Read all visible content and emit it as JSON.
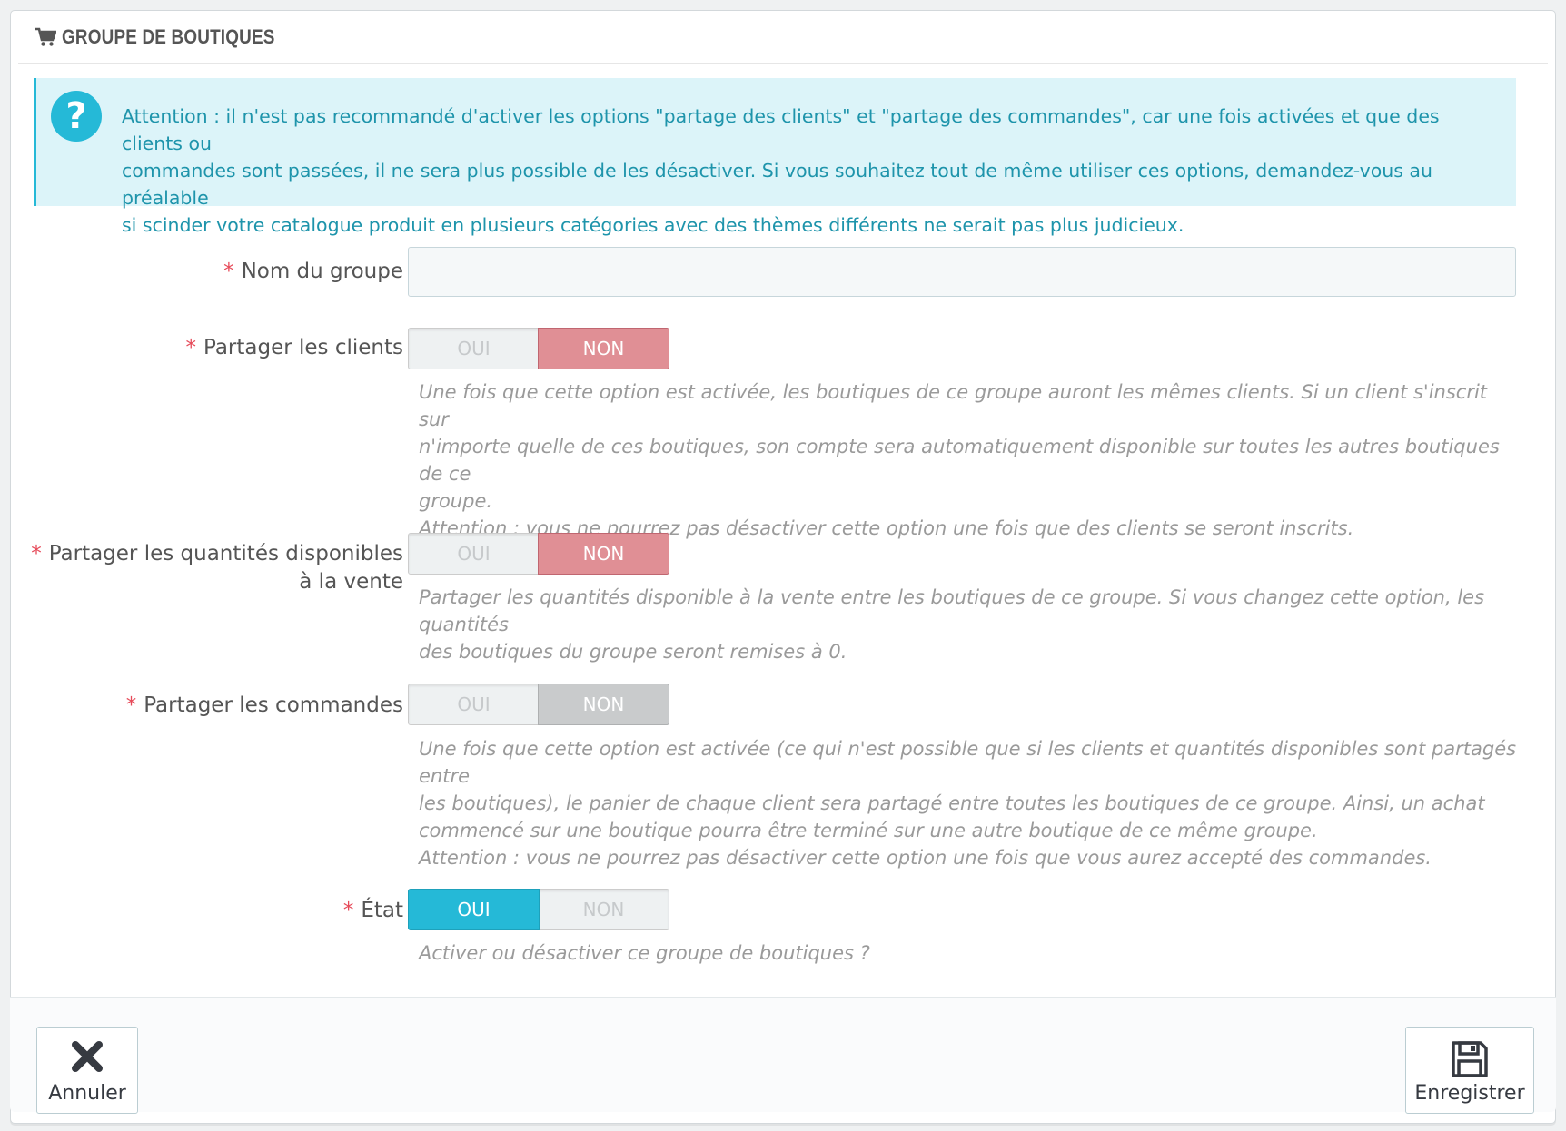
{
  "panel": {
    "title": "GROUPE DE BOUTIQUES",
    "icon": "cart-icon"
  },
  "alert": {
    "icon": "question-icon",
    "text": "Attention : il n'est pas recommandé d'activer les options \"partage des clients\" et \"partage des commandes\", car une fois activées et que des clients ou\ncommandes sont passées, il ne sera plus possible de les désactiver. Si vous souhaitez tout de même utiliser ces options, demandez-vous au préalable\nsi scinder votre catalogue produit en plusieurs catégories avec des thèmes différents ne serait pas plus judicieux."
  },
  "fields": {
    "group_name": {
      "label": "Nom du groupe",
      "value": ""
    },
    "share_customers": {
      "label": "Partager les clients",
      "yes": "OUI",
      "no": "NON",
      "selected": "NON",
      "help": "Une fois que cette option est activée, les boutiques de ce groupe auront les mêmes clients. Si un client s'inscrit sur\nn'importe quelle de ces boutiques, son compte sera automatiquement disponible sur toutes les autres boutiques de ce\ngroupe.\nAttention : vous ne pourrez pas désactiver cette option une fois que des clients se seront inscrits."
    },
    "share_stock": {
      "label": "Partager les quantités disponibles\nà la vente",
      "yes": "OUI",
      "no": "NON",
      "selected": "NON",
      "help": "Partager les quantités disponible à la vente entre les boutiques de ce groupe. Si vous changez cette option, les quantités\ndes boutiques du groupe seront remises à 0."
    },
    "share_orders": {
      "label": "Partager les commandes",
      "yes": "OUI",
      "no": "NON",
      "selected": "NON",
      "help": "Une fois que cette option est activée (ce qui n'est possible que si les clients et quantités disponibles sont partagés entre\nles boutiques), le panier de chaque client sera partagé entre toutes les boutiques de ce groupe. Ainsi, un achat\ncommencé sur une boutique pourra être terminé sur une autre boutique de ce même groupe.\nAttention : vous ne pourrez pas désactiver cette option une fois que vous aurez accepté des commandes."
    },
    "status": {
      "label": "État",
      "yes": "OUI",
      "no": "NON",
      "selected": "OUI",
      "help": "Activer ou désactiver ce groupe de boutiques ?"
    }
  },
  "required_mark": "*",
  "footer": {
    "cancel_label": "Annuler",
    "cancel_icon": "close-icon",
    "save_label": "Enregistrer",
    "save_icon": "floppy-disk-icon"
  },
  "colors": {
    "accent": "#25b9d7",
    "no_active": "#e08f95",
    "disabled_active": "#c9cbcc",
    "required": "#e64a59"
  }
}
